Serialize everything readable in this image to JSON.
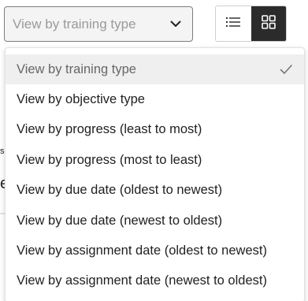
{
  "filter": {
    "selected_label": "View by training type",
    "options": [
      "View by training type",
      "View by objective type",
      "View by progress (least to most)",
      "View by progress (most to least)",
      "View by due date (oldest to newest)",
      "View by due date (newest to oldest)",
      "View by assignment date (oldest to newest)",
      "View by assignment date (newest to oldest)"
    ]
  },
  "view_toggle": {
    "active": "grid",
    "list_icon": "list-view-icon",
    "grid_icon": "grid-view-icon"
  },
  "background": {
    "fragment_1": "so",
    "fragment_2": "e"
  },
  "colors": {
    "active_toggle_bg": "#2b2b2b",
    "selected_option_bg": "#efefef"
  }
}
